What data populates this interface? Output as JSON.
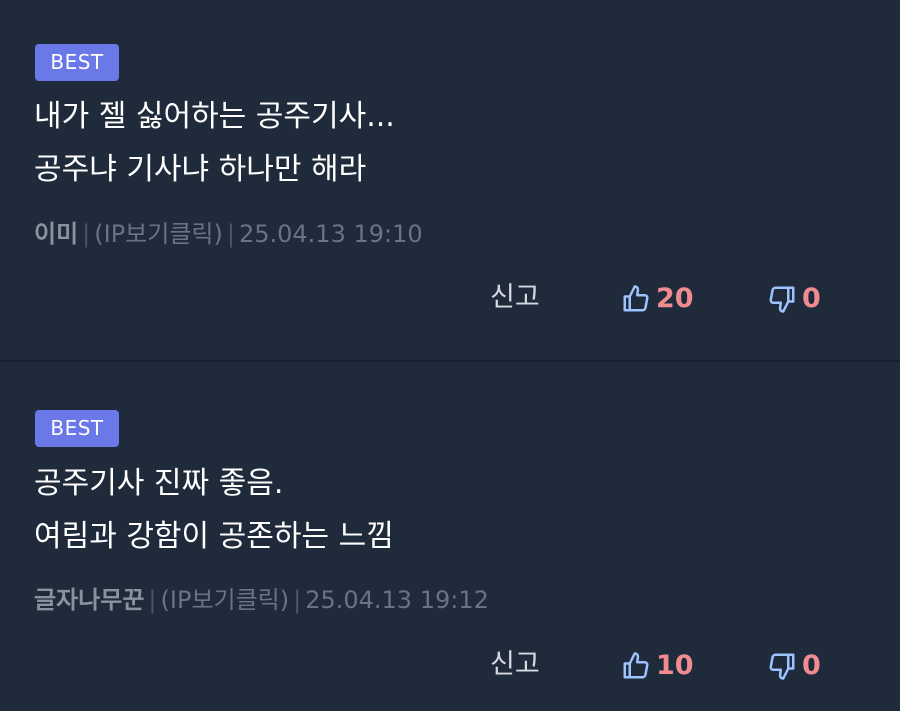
{
  "comments": [
    {
      "badge": "BEST",
      "line1": "내가 젤 싫어하는 공주기사...",
      "line2": "공주냐 기사냐 하나만 해라",
      "author": "이미",
      "ip": "(IP보기클릭)",
      "datetime": "25.04.13 19:10",
      "report": "신고",
      "likes": "20",
      "dislikes": "0"
    },
    {
      "badge": "BEST",
      "line1": "공주기사 진짜 좋음.",
      "line2": "여림과 강함이 공존하는 느낌",
      "author": "글자나무꾼",
      "ip": "(IP보기클릭)",
      "datetime": "25.04.13 19:12",
      "report": "신고",
      "likes": "10",
      "dislikes": "0"
    }
  ],
  "meta_separator": "|",
  "colors": {
    "background": "#1f2a3b",
    "badge": "#6b78e8",
    "like_icon": "#9ec3ff",
    "count": "#f08b8f"
  },
  "icons": {
    "like": "thumbs-up-icon",
    "dislike": "thumbs-down-icon"
  }
}
